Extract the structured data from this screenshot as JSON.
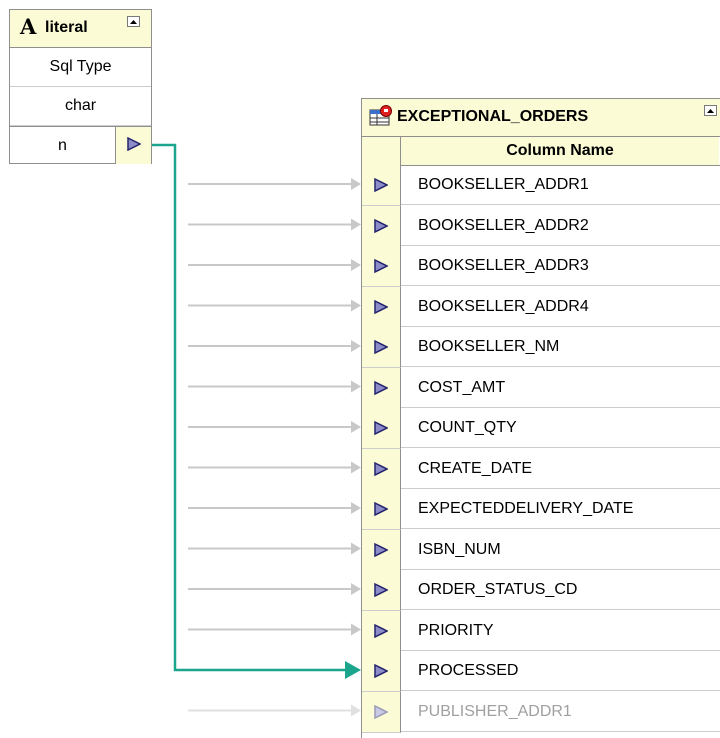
{
  "literal": {
    "glyph": "A",
    "title": "literal",
    "attributes": [
      "Sql Type",
      "char"
    ],
    "port_name": "n"
  },
  "table": {
    "title": "EXCEPTIONAL_ORDERS",
    "column_header": "Column Name",
    "columns": [
      "BOOKSELLER_ADDR1",
      "BOOKSELLER_ADDR2",
      "BOOKSELLER_ADDR3",
      "BOOKSELLER_ADDR4",
      "BOOKSELLER_NM",
      "COST_AMT",
      "COUNT_QTY",
      "CREATE_DATE",
      "EXPECTEDDELIVERY_DATE",
      "ISBN_NUM",
      "ORDER_STATUS_CD",
      "PRIORITY",
      "PROCESSED",
      "PUBLISHER_ADDR1"
    ],
    "mapped_column": "PROCESSED"
  },
  "colors": {
    "header_fill": "#fbfbd6",
    "border": "#8f8f8f",
    "port_arrow": "#24246e",
    "mapping_line": "#1aa58c",
    "unmapped_line": "#c8c8c8"
  },
  "icons": {
    "literal": "literal-A-glyph",
    "table": "table-icon",
    "collapse": "collapse-up-icon",
    "port": "port-arrow-icon"
  }
}
